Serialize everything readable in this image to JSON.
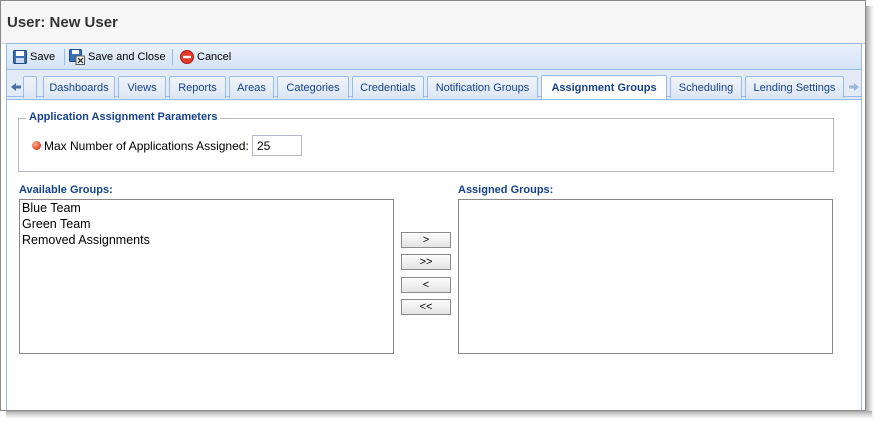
{
  "window": {
    "title": "User: New User"
  },
  "toolbar": {
    "save_label": "Save",
    "save_close_label": "Save and Close",
    "cancel_label": "Cancel"
  },
  "tabs": [
    {
      "label": "Dashboards",
      "active": false
    },
    {
      "label": "Views",
      "active": false
    },
    {
      "label": "Reports",
      "active": false
    },
    {
      "label": "Areas",
      "active": false
    },
    {
      "label": "Categories",
      "active": false
    },
    {
      "label": "Credentials",
      "active": false
    },
    {
      "label": "Notification Groups",
      "active": false
    },
    {
      "label": "Assignment Groups",
      "active": true
    },
    {
      "label": "Scheduling",
      "active": false
    },
    {
      "label": "Lending Settings",
      "active": false
    }
  ],
  "params": {
    "legend": "Application Assignment Parameters",
    "max_label": "Max Number of Applications Assigned:",
    "max_value": "25"
  },
  "available": {
    "label": "Available Groups:",
    "items": [
      "Blue Team",
      "Green Team",
      "Removed Assignments"
    ]
  },
  "assigned": {
    "label": "Assigned Groups:",
    "items": []
  },
  "move_buttons": {
    "add": ">",
    "add_all": ">>",
    "remove": "<",
    "remove_all": "<<"
  },
  "colors": {
    "accent": "#15428b",
    "border": "#99bbe8",
    "required": "#e0401b"
  }
}
